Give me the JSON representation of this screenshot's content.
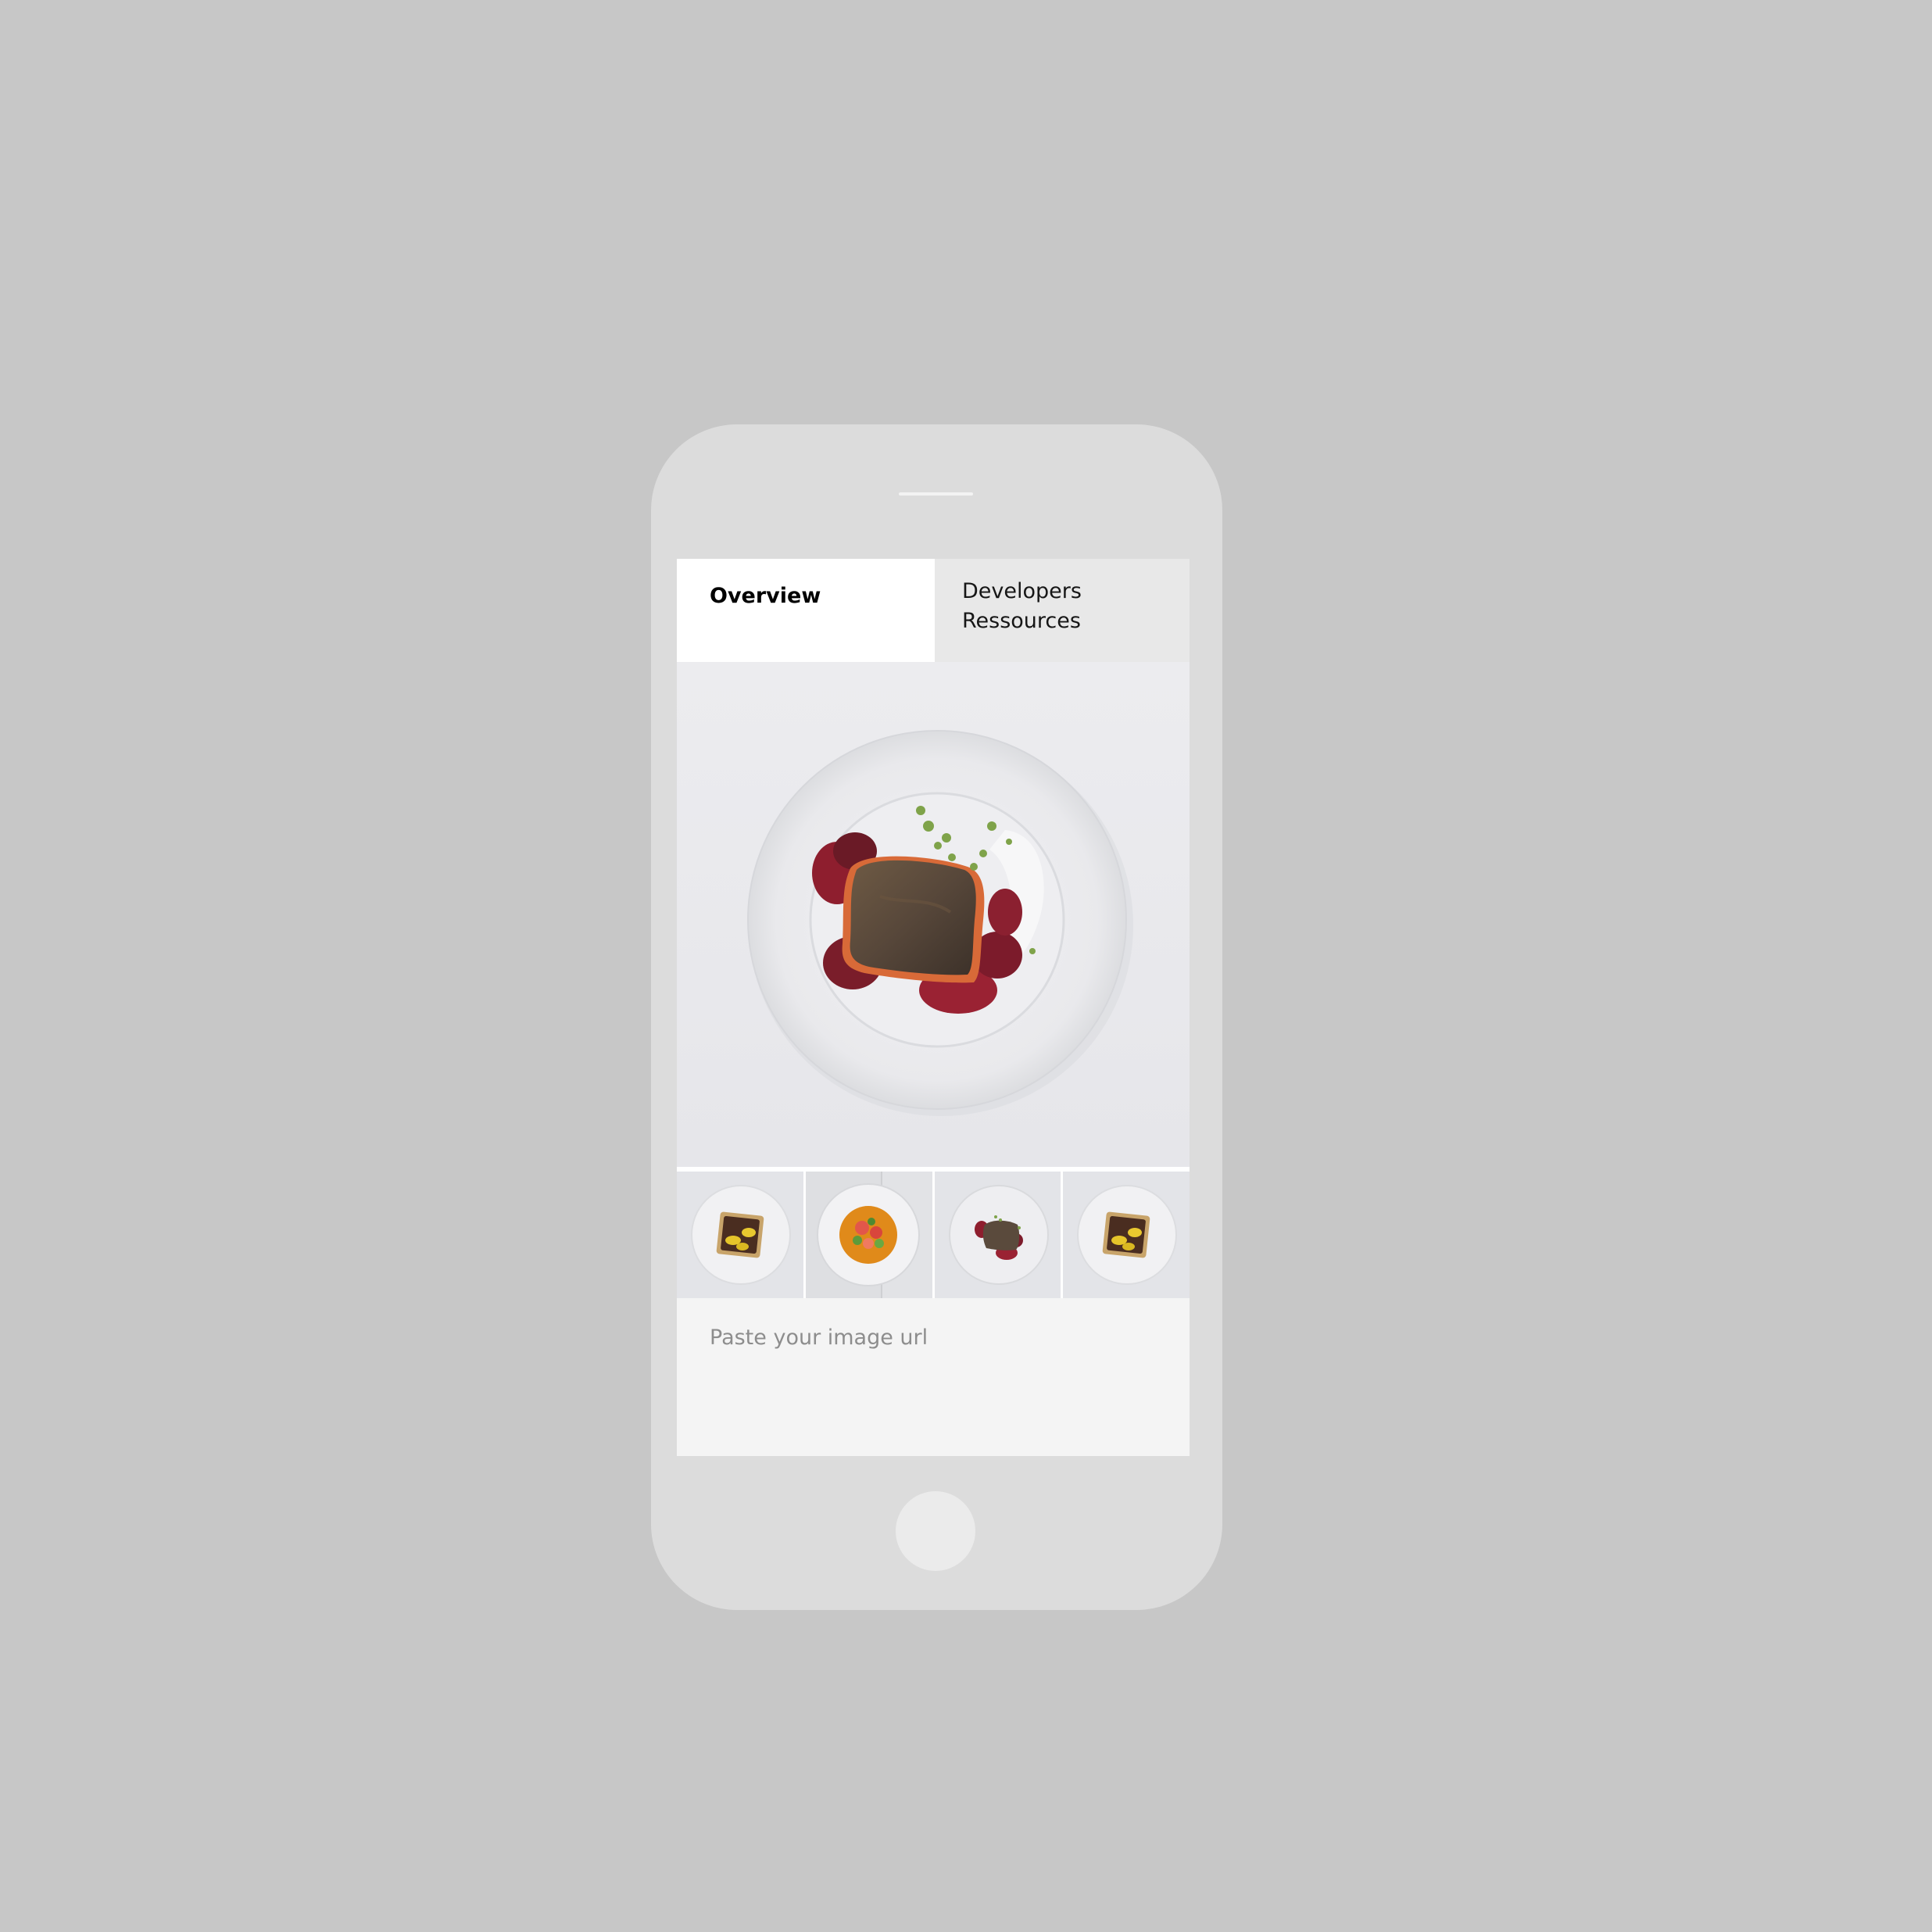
{
  "tabs": [
    {
      "label": "Overview",
      "selected": true
    },
    {
      "label_line1": "Developers",
      "label_line2": "Ressources",
      "selected": false
    }
  ],
  "hero_image": {
    "icon": "salmon-beet-plate-photo"
  },
  "thumbnails": [
    {
      "icon": "toast-plate-thumbnail"
    },
    {
      "icon": "salad-bowl-thumbnail"
    },
    {
      "icon": "salmon-plate-thumbnail"
    },
    {
      "icon": "toast-plate-thumbnail"
    }
  ],
  "url_input": {
    "placeholder": "Paste your image url",
    "value": ""
  },
  "colors": {
    "background": "#c7c7c7",
    "phone_body": "#dcdcdc",
    "tab_selected": "#ffffff",
    "tab_unselected": "#e8e8e8",
    "input_background": "#f4f4f4",
    "placeholder_text": "#8d8d8d"
  }
}
